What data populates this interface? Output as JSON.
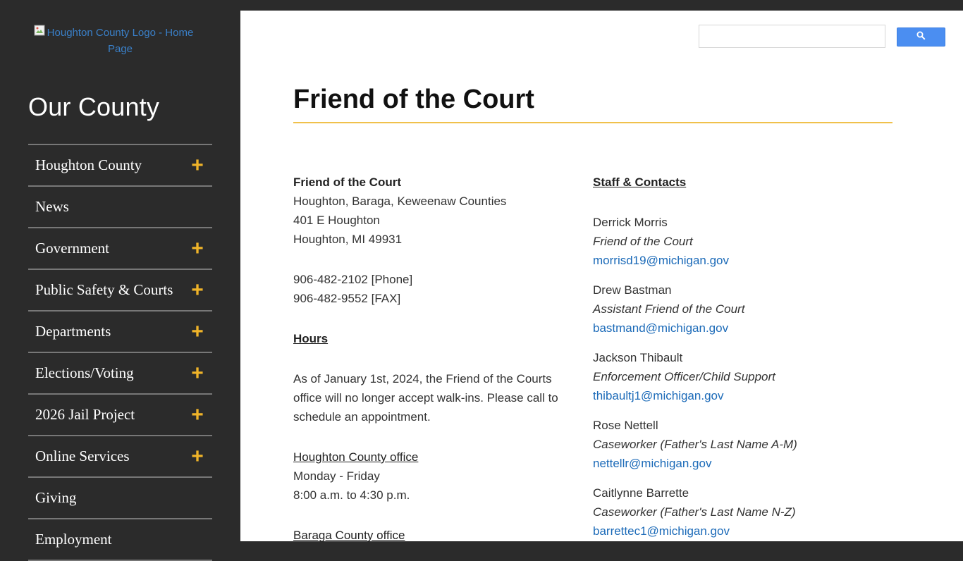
{
  "sidebar": {
    "logo_alt": "Houghton County Logo - Home Page",
    "heading": "Our County",
    "items": [
      {
        "label": "Houghton County",
        "expandable": true
      },
      {
        "label": "News",
        "expandable": false
      },
      {
        "label": "Government",
        "expandable": true
      },
      {
        "label": "Public Safety & Courts",
        "expandable": true
      },
      {
        "label": "Departments",
        "expandable": true
      },
      {
        "label": "Elections/Voting",
        "expandable": true
      },
      {
        "label": "2026 Jail Project",
        "expandable": true
      },
      {
        "label": "Online Services",
        "expandable": true
      },
      {
        "label": "Giving",
        "expandable": false
      },
      {
        "label": "Employment",
        "expandable": false
      }
    ],
    "plus_symbol": "+"
  },
  "search": {
    "placeholder": ""
  },
  "page": {
    "title": "Friend of the Court",
    "address": {
      "name": "Friend of the Court",
      "line1": "Houghton, Baraga, Keweenaw Counties",
      "line2": "401 E Houghton",
      "line3": "Houghton, MI 49931"
    },
    "phone": "906-482-2102 [Phone]",
    "fax": "906-482-9552 [FAX]",
    "hours_heading": "Hours",
    "hours_notice": "As of January 1st, 2024, the Friend of the Courts office will no longer accept walk-ins. Please call to schedule an appointment.",
    "offices": [
      {
        "name": "Houghton County office",
        "days": "Monday - Friday",
        "time": "8:00 a.m. to 4:30 p.m."
      },
      {
        "name": "Baraga County office"
      }
    ],
    "staff_heading": "Staff & Contacts",
    "staff": [
      {
        "name": "Derrick Morris",
        "role": "Friend of the Court",
        "email": "morrisd19@michigan.gov"
      },
      {
        "name": "Drew Bastman",
        "role": "Assistant Friend of the Court",
        "email": "bastmand@michigan.gov"
      },
      {
        "name": "Jackson Thibault",
        "role": "Enforcement Officer/Child Support",
        "email": "thibaultj1@michigan.gov"
      },
      {
        "name": "Rose Nettell",
        "role": "Caseworker (Father's Last Name A-M)",
        "email": "nettellr@michigan.gov"
      },
      {
        "name": "Caitlynne Barrette",
        "role": "Caseworker (Father's Last Name N-Z)",
        "email": "barrettec1@michigan.gov"
      }
    ]
  },
  "colors": {
    "sidebar_bg": "#2b2b2b",
    "accent_plus": "#f0b429",
    "title_underline": "#f0c14b",
    "link": "#1b6ab8",
    "search_button": "#4b8ef1"
  }
}
